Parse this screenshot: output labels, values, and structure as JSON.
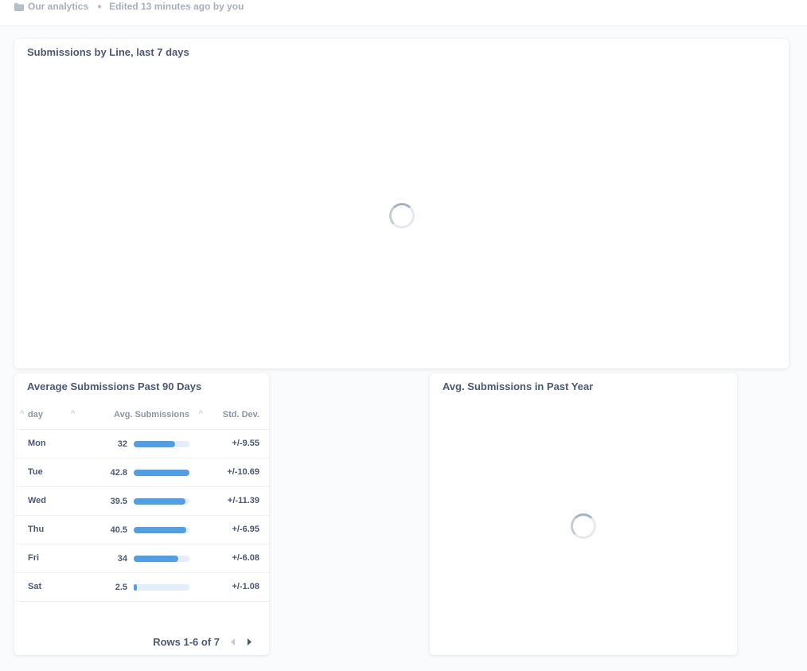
{
  "header": {
    "collection": "Our analytics",
    "edited": "Edited 13 minutes ago by you"
  },
  "cards": {
    "line_chart": {
      "title": "Submissions by Line, last 7 days"
    },
    "table": {
      "title": "Average Submissions Past 90 Days",
      "columns": [
        "day",
        "Avg. Submissions",
        "Std. Dev."
      ],
      "rows": [
        {
          "day": "Mon",
          "avg": "32",
          "std": "+/-9.55"
        },
        {
          "day": "Tue",
          "avg": "42.8",
          "std": "+/-10.69"
        },
        {
          "day": "Wed",
          "avg": "39.5",
          "std": "+/-11.39"
        },
        {
          "day": "Thu",
          "avg": "40.5",
          "std": "+/-6.95"
        },
        {
          "day": "Fri",
          "avg": "34",
          "std": "+/-6.08"
        },
        {
          "day": "Sat",
          "avg": "2.5",
          "std": "+/-1.08"
        }
      ],
      "pagination": "Rows 1-6 of 7"
    },
    "year_chart": {
      "title": "Avg. Submissions in Past Year"
    }
  },
  "colors": {
    "accent": "#509ee3",
    "track": "#e3eefa"
  }
}
